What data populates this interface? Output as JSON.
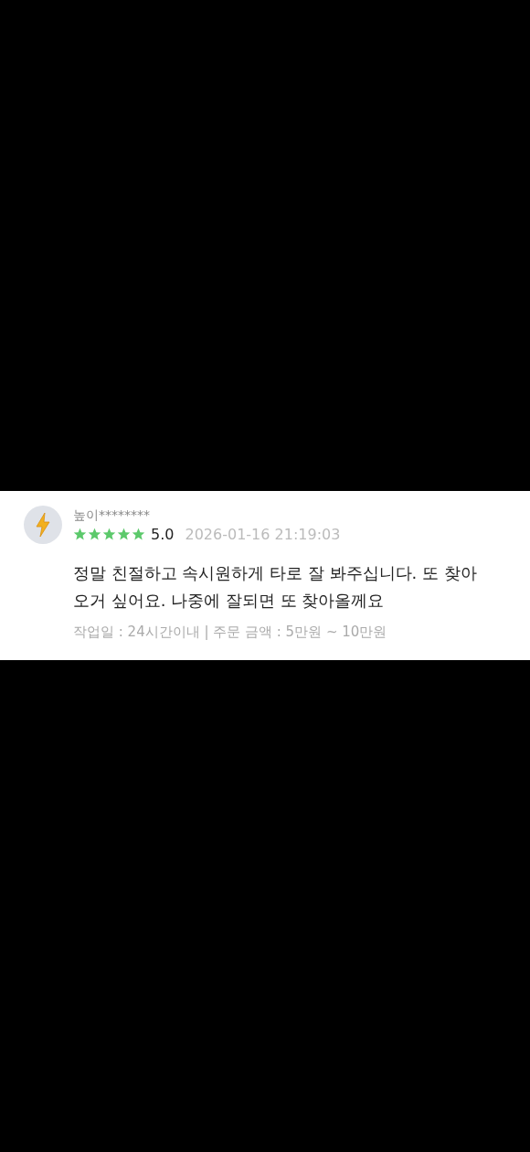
{
  "review": {
    "author": "높이********",
    "stars": 5,
    "rating": "5.0",
    "date": "2026-01-16 21:19:03",
    "text": "정말 친절하고 속시원하게 타로 잘 봐주십니다. 또 찾아오거 싶어요. 나중에 잘되면 또 찾아올께요",
    "meta": "작업일 : 24시간이내 | 주문 금액 : 5만원 ~ 10만원"
  }
}
